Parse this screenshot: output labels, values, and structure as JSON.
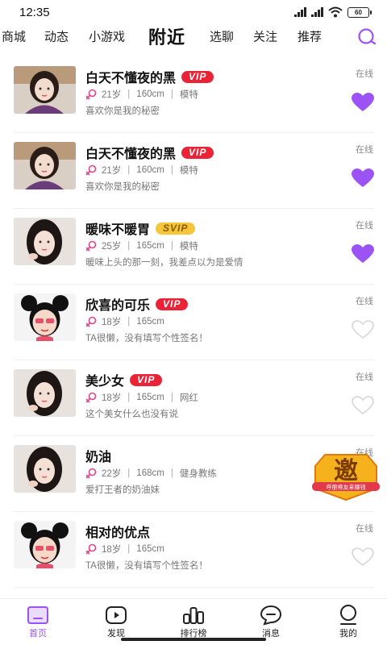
{
  "status_bar": {
    "time": "12:35",
    "battery": "60"
  },
  "tabs": [
    {
      "label": "商城",
      "active": false
    },
    {
      "label": "动态",
      "active": false
    },
    {
      "label": "小游戏",
      "active": false
    },
    {
      "label": "附近",
      "active": true
    },
    {
      "label": "选聊",
      "active": false
    },
    {
      "label": "关注",
      "active": false
    },
    {
      "label": "推荐",
      "active": false
    }
  ],
  "users": [
    {
      "name": "白天不懂夜的黑",
      "badge": "VIP",
      "age": "21岁",
      "height": "160cm",
      "job": "模特",
      "sign": "喜欢你是我的秘密",
      "status": "在线",
      "liked": true,
      "avatar_icon": "girl-photo"
    },
    {
      "name": "白天不懂夜的黑",
      "badge": "VIP",
      "age": "21岁",
      "height": "160cm",
      "job": "模特",
      "sign": "喜欢你是我的秘密",
      "status": "在线",
      "liked": true,
      "avatar_icon": "girl-photo"
    },
    {
      "name": "暖味不暖胃",
      "badge": "SVIP",
      "age": "25岁",
      "height": "165cm",
      "job": "模特",
      "sign": "暖味上头的那一刻，我差点以为是爱情",
      "status": "在线",
      "liked": true,
      "avatar_icon": "girl-photo"
    },
    {
      "name": "欣喜的可乐",
      "badge": "VIP",
      "age": "18岁",
      "height": "165cm",
      "job": "",
      "sign": "TA很懒，没有填写个性签名！",
      "status": "在线",
      "liked": false,
      "avatar_icon": "cartoon-avatar"
    },
    {
      "name": "美少女",
      "badge": "VIP",
      "age": "18岁",
      "height": "165cm",
      "job": "网红",
      "sign": "这个美女什么也没有说",
      "status": "在线",
      "liked": false,
      "avatar_icon": "girl-photo"
    },
    {
      "name": "奶油",
      "badge": "",
      "age": "22岁",
      "height": "168cm",
      "job": "健身教练",
      "sign": "爱打王者的奶油妹",
      "status": "在线",
      "liked": false,
      "avatar_icon": "girl-photo"
    },
    {
      "name": "相对的优点",
      "badge": "",
      "age": "18岁",
      "height": "165cm",
      "job": "",
      "sign": "TA很懒，没有填写个性签名！",
      "status": "在线",
      "liked": false,
      "avatar_icon": "cartoon-avatar"
    }
  ],
  "promo": {
    "big_char": "邀",
    "caption": "呼朋唤友来赚钱"
  },
  "bottom_nav": [
    {
      "label": "首页",
      "icon": "home-icon",
      "active": true
    },
    {
      "label": "发现",
      "icon": "discover-icon",
      "active": false
    },
    {
      "label": "排行榜",
      "icon": "ranking-icon",
      "active": false
    },
    {
      "label": "消息",
      "icon": "message-icon",
      "active": false
    },
    {
      "label": "我的",
      "icon": "profile-icon",
      "active": false
    }
  ],
  "colors": {
    "accent": "#9b53f5",
    "vip": "#ea2436",
    "svip": "#f5c63a",
    "gender": "#e0458a"
  }
}
